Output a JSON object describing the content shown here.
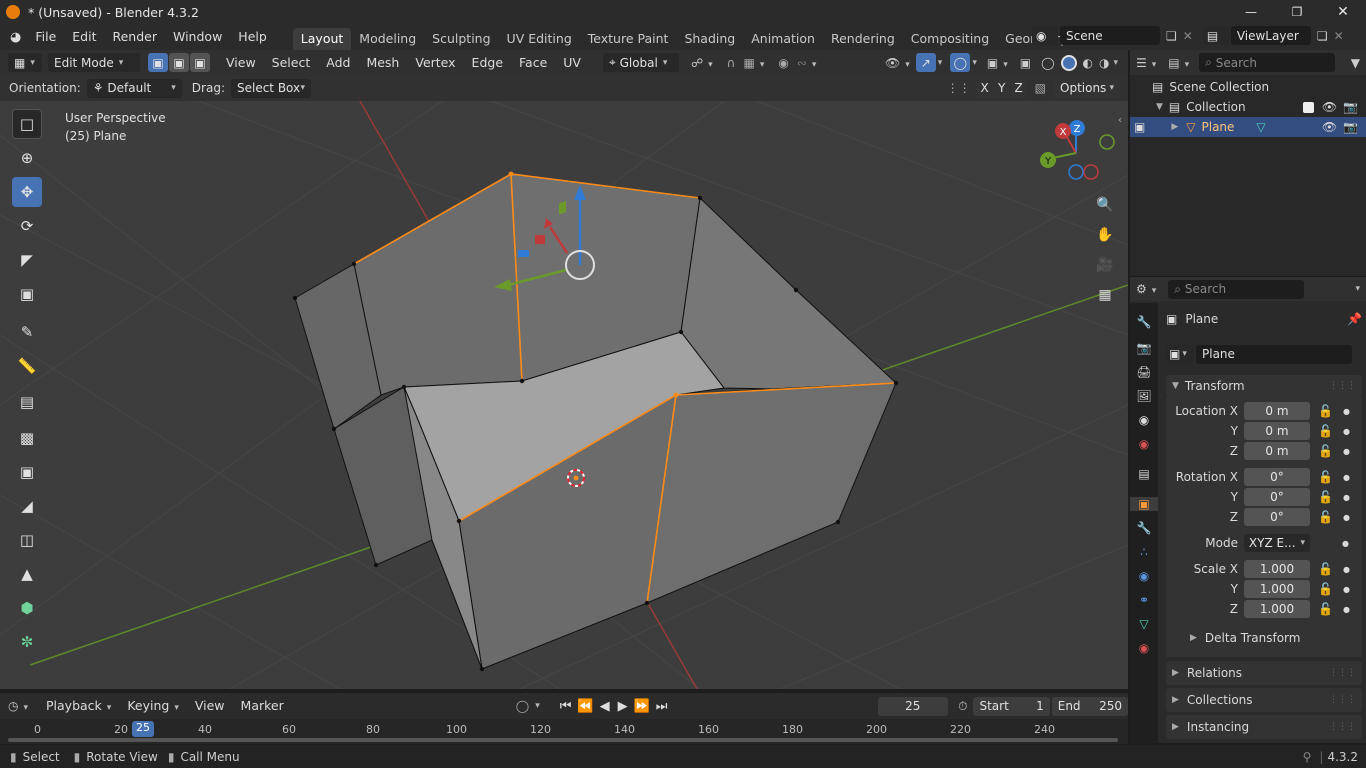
{
  "window": {
    "title": "* (Unsaved) - Blender 4.3.2"
  },
  "menus": [
    "File",
    "Edit",
    "Render",
    "Window",
    "Help"
  ],
  "workspace_tabs": [
    "Layout",
    "Modeling",
    "Sculpting",
    "UV Editing",
    "Texture Paint",
    "Shading",
    "Animation",
    "Rendering",
    "Compositing",
    "Geometry Node"
  ],
  "active_tab": "Layout",
  "scene": {
    "name": "Scene",
    "view_layer": "ViewLayer"
  },
  "viewport_header": {
    "mode": "Edit Mode",
    "menus": [
      "View",
      "Select",
      "Add",
      "Mesh",
      "Vertex",
      "Edge",
      "Face",
      "UV"
    ],
    "transform_orientation": "Global"
  },
  "tool_settings": {
    "orientation_label": "Orientation:",
    "orientation_value": "Default",
    "drag_label": "Drag:",
    "drag_value": "Select Box",
    "axis_x": "X",
    "axis_y": "Y",
    "axis_z": "Z",
    "options": "Options"
  },
  "viewport": {
    "perspective": "User Perspective",
    "object_info": "(25) Plane"
  },
  "gizmo": {
    "x": "X",
    "y": "Y",
    "z": "Z"
  },
  "outliner": {
    "search_placeholder": "Search",
    "scene_collection": "Scene Collection",
    "collection": "Collection",
    "object": "Plane"
  },
  "properties": {
    "search_placeholder": "Search",
    "object_name": "Plane",
    "datablock": "Plane",
    "transform_label": "Transform",
    "location": {
      "label": "Location X",
      "x": "0 m",
      "y": "0 m",
      "z": "0 m"
    },
    "rotation": {
      "label": "Rotation X",
      "x": "0°",
      "y": "0°",
      "z": "0°"
    },
    "mode": {
      "label": "Mode",
      "value": "XYZ E..."
    },
    "scale": {
      "label": "Scale X",
      "x": "1.000",
      "y": "1.000",
      "z": "1.000"
    },
    "axis_y": "Y",
    "axis_z": "Z",
    "delta_transform": "Delta Transform",
    "relations": "Relations",
    "collections": "Collections",
    "instancing": "Instancing"
  },
  "timeline": {
    "menus": [
      "Playback",
      "Keying",
      "View",
      "Marker"
    ],
    "current_frame": "25",
    "start_label": "Start",
    "start": "1",
    "end_label": "End",
    "end": "250",
    "ruler": [
      "0",
      "20",
      "40",
      "60",
      "80",
      "100",
      "120",
      "140",
      "160",
      "180",
      "200",
      "220",
      "240"
    ]
  },
  "statusbar": {
    "select": "Select",
    "rotate": "Rotate View",
    "menu": "Call Menu",
    "version": "4.3.2"
  },
  "colors": {
    "accent": "#4772b3",
    "selected": "#ff8c1a",
    "x_axis": "#c0393b",
    "y_axis": "#6a9b2a",
    "z_axis": "#2f7bd6"
  }
}
